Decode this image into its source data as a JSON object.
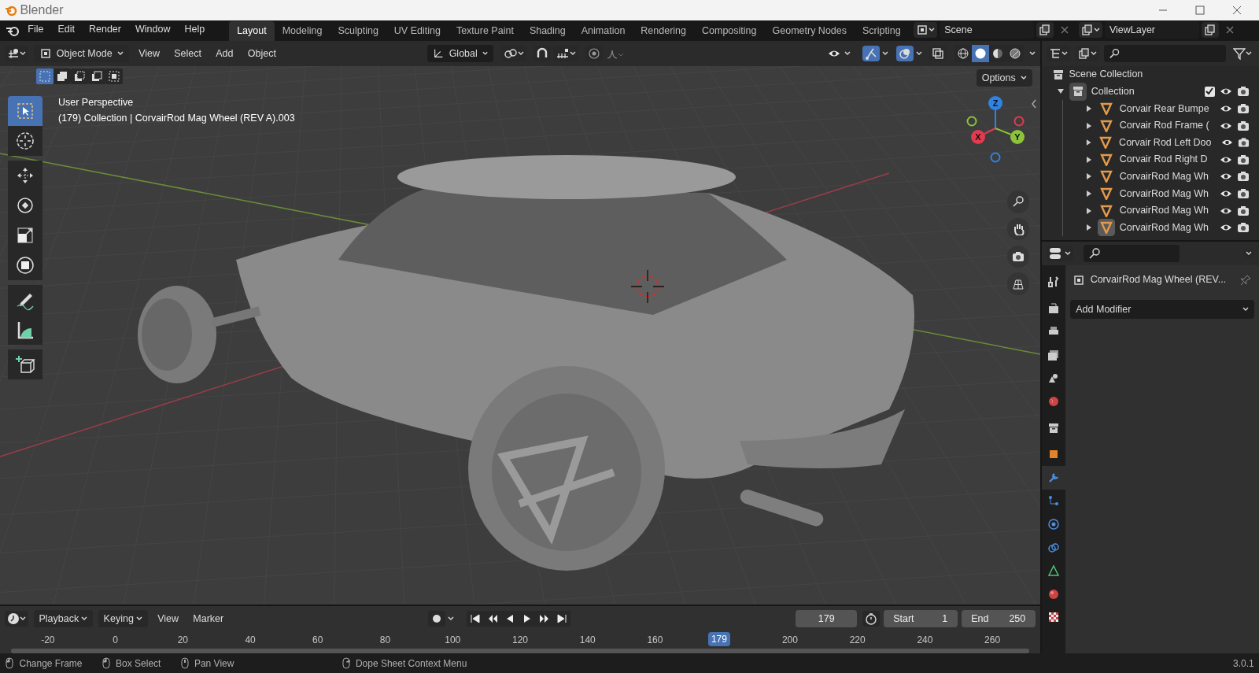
{
  "window": {
    "title": "Blender"
  },
  "menu": [
    "File",
    "Edit",
    "Render",
    "Window",
    "Help"
  ],
  "workspaces": [
    {
      "label": "Layout",
      "selected": true
    },
    {
      "label": "Modeling",
      "selected": false
    },
    {
      "label": "Sculpting",
      "selected": false
    },
    {
      "label": "UV Editing",
      "selected": false
    },
    {
      "label": "Texture Paint",
      "selected": false
    },
    {
      "label": "Shading",
      "selected": false
    },
    {
      "label": "Animation",
      "selected": false
    },
    {
      "label": "Rendering",
      "selected": false
    },
    {
      "label": "Compositing",
      "selected": false
    },
    {
      "label": "Geometry Nodes",
      "selected": false
    },
    {
      "label": "Scripting",
      "selected": false
    }
  ],
  "scene": {
    "value": "Scene"
  },
  "view_layer": {
    "value": "ViewLayer"
  },
  "viewport": {
    "mode": "Object Mode",
    "menus": [
      "View",
      "Select",
      "Add",
      "Object"
    ],
    "orientation": "Global",
    "options": "Options",
    "toggles": [
      {
        "kind": "gizmo",
        "on": true
      },
      {
        "kind": "overlay",
        "on": true
      },
      {
        "kind": "xray",
        "on": false
      }
    ],
    "shading": [
      {
        "kind": "wireframe",
        "selected": false
      },
      {
        "kind": "solid",
        "selected": true
      },
      {
        "kind": "material",
        "selected": false
      },
      {
        "kind": "rendered",
        "selected": false
      }
    ],
    "select_modes": [
      {
        "kind": "new",
        "selected": true
      },
      {
        "kind": "extend",
        "selected": false
      },
      {
        "kind": "subtract",
        "selected": false
      },
      {
        "kind": "invert",
        "selected": false
      },
      {
        "kind": "intersect",
        "selected": false
      }
    ],
    "info": [
      "User Perspective",
      "(179) Collection | CorvairRod Mag Wheel (REV A).003"
    ],
    "tools": [
      {
        "kind": "select",
        "selected": true
      },
      {
        "kind": "cursor",
        "selected": false
      },
      {
        "kind": "move",
        "selected": false
      },
      {
        "kind": "rotate",
        "selected": false
      },
      {
        "kind": "scale",
        "selected": false
      },
      {
        "kind": "transform",
        "selected": false
      },
      {
        "kind": "annotate",
        "selected": false
      },
      {
        "kind": "measure",
        "selected": false
      },
      {
        "kind": "add-cube",
        "selected": false
      }
    ],
    "gizmo_axes": [
      {
        "label": "Z",
        "color": "#2f83e3"
      },
      {
        "label": "Y",
        "color": "#8bc43a"
      },
      {
        "label": "X",
        "color": "#e33a4f"
      }
    ]
  },
  "outliner": {
    "root": "Scene Collection",
    "children": [
      {
        "label": "Collection",
        "expanded": true,
        "checked": true,
        "children": [
          {
            "label": "Corvair Rear Bumpe",
            "expanded": false,
            "selected": false
          },
          {
            "label": "Corvair Rod Frame (",
            "expanded": false,
            "selected": false
          },
          {
            "label": "Corvair Rod Left Doo",
            "expanded": false,
            "selected": false
          },
          {
            "label": "Corvair Rod Right D",
            "expanded": false,
            "selected": false
          },
          {
            "label": "CorvairRod Mag Wh",
            "expanded": false,
            "selected": false
          },
          {
            "label": "CorvairRod Mag Wh",
            "expanded": false,
            "selected": false
          },
          {
            "label": "CorvairRod Mag Wh",
            "expanded": false,
            "selected": false
          },
          {
            "label": "CorvairRod Mag Wh",
            "expanded": false,
            "selected": true
          }
        ]
      }
    ]
  },
  "properties": {
    "object": "CorvairRod Mag Wheel (REV...",
    "add_modifier": "Add Modifier",
    "tabs": [
      {
        "kind": "tool",
        "selected": false
      },
      {
        "kind": "render",
        "selected": false
      },
      {
        "kind": "output",
        "selected": false
      },
      {
        "kind": "view-layer",
        "selected": false
      },
      {
        "kind": "scene",
        "selected": false
      },
      {
        "kind": "world",
        "selected": false
      },
      {
        "kind": "collection",
        "selected": false
      },
      {
        "kind": "object",
        "selected": false
      },
      {
        "kind": "modifier",
        "selected": true
      },
      {
        "kind": "particles",
        "selected": false
      },
      {
        "kind": "physics",
        "selected": false
      },
      {
        "kind": "constraints",
        "selected": false
      },
      {
        "kind": "data",
        "selected": false
      },
      {
        "kind": "material",
        "selected": false
      },
      {
        "kind": "texture",
        "selected": false
      }
    ]
  },
  "timeline": {
    "menus": [
      {
        "label": "Playback",
        "dropdown": true
      },
      {
        "label": "Keying",
        "dropdown": true
      },
      {
        "label": "View",
        "dropdown": false
      },
      {
        "label": "Marker",
        "dropdown": false
      }
    ],
    "current_frame": "179",
    "start_label": "Start",
    "start": "1",
    "end_label": "End",
    "end": "250",
    "ruler": [
      "-20",
      "0",
      "20",
      "40",
      "60",
      "80",
      "100",
      "120",
      "140",
      "160",
      "200",
      "220",
      "240",
      "260"
    ],
    "playhead": "179"
  },
  "status_bar": {
    "items": [
      "Change Frame",
      "Box Select",
      "Pan View",
      "Dope Sheet Context Menu"
    ],
    "version": "3.0.1"
  }
}
